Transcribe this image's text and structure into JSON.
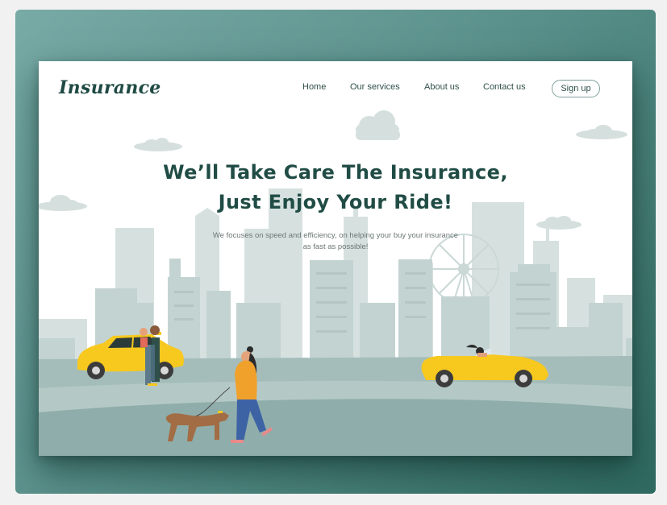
{
  "brand": {
    "logo": "Insurance"
  },
  "nav": {
    "home": "Home",
    "services": "Our services",
    "about": "About us",
    "contact": "Contact us",
    "signup": "Sign up"
  },
  "hero": {
    "headline_line1": "We’ll Take Care The Insurance,",
    "headline_line2": "Just Enjoy Your Ride!",
    "subtitle_line1": "We focuses on speed and efficiency, on helping your buy your insurance",
    "subtitle_line2": "as fast as possible!"
  },
  "colors": {
    "frame_gradient_start": "#78aaa6",
    "frame_gradient_end": "#2f6a60",
    "brand_dark": "#204c45",
    "city": "#c3d3d1",
    "ground": "#8fadaa",
    "car_yellow": "#f7c81e",
    "jacket_orange": "#f0a12c",
    "dog_brown": "#a26d44"
  },
  "illustration": {
    "elements": [
      "city-skyline",
      "ferris-wheel",
      "clouds",
      "yellow-taxi",
      "couple",
      "woman-walking-dog",
      "yellow-convertible"
    ]
  }
}
